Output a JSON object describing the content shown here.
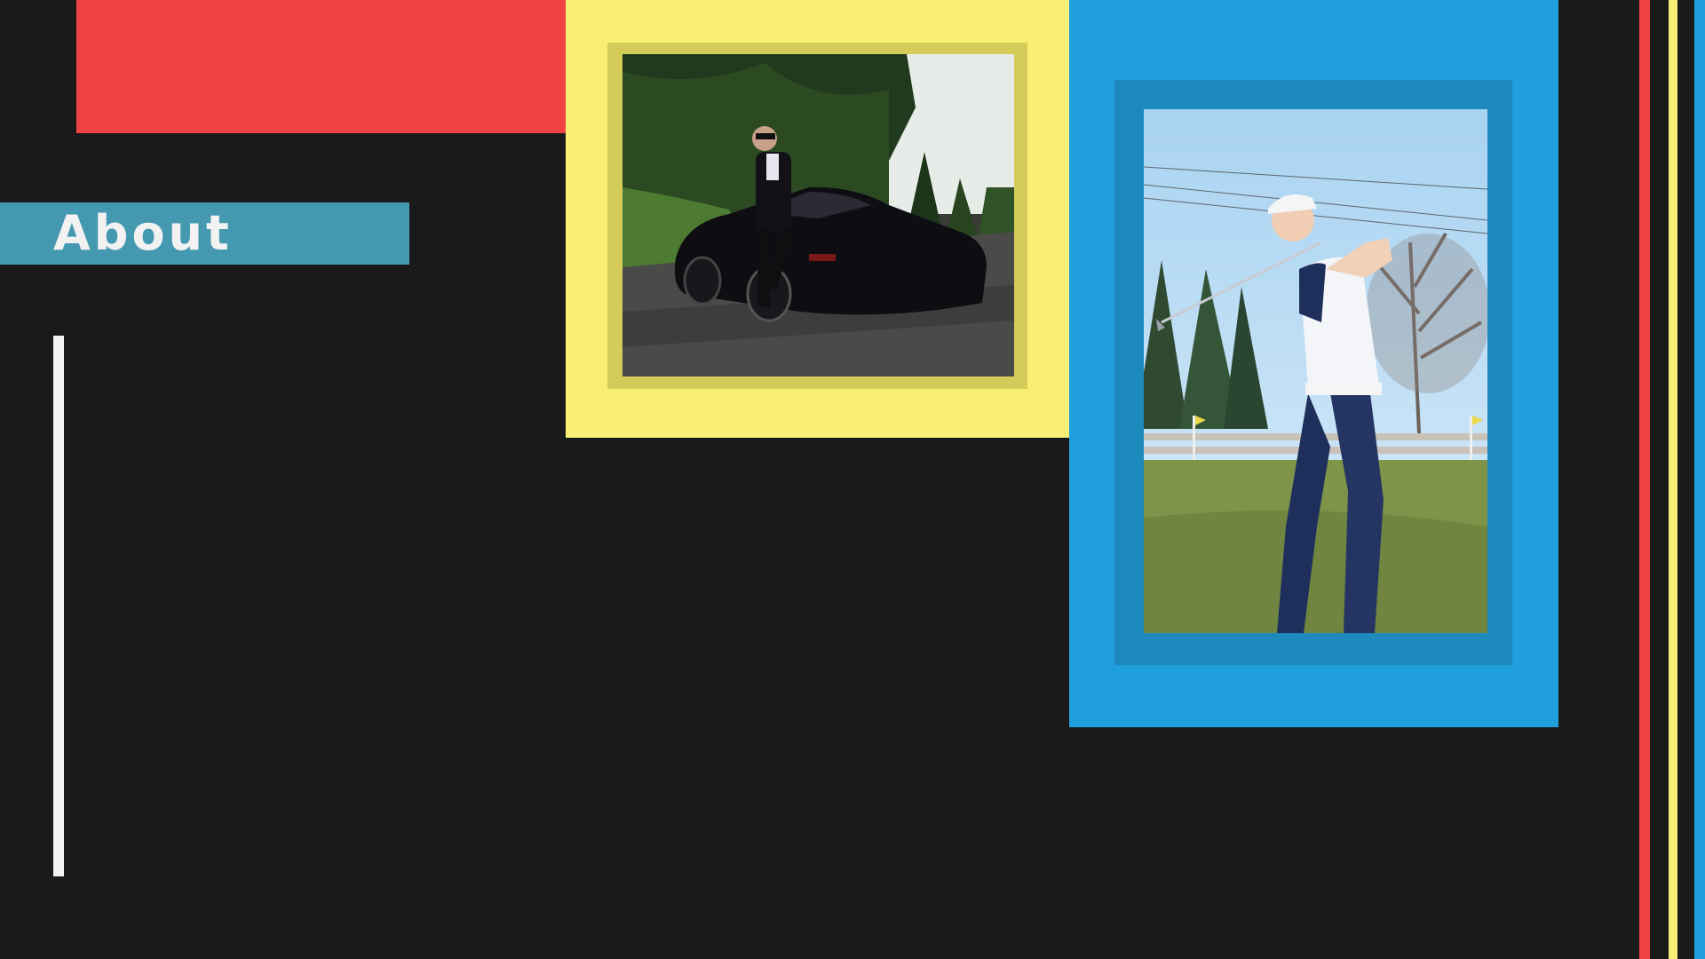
{
  "slide": {
    "title": "About",
    "colors": {
      "background": "#1a1a1a",
      "red": "#f04444",
      "yellow": "#f8ef74",
      "blue": "#1f9fdb",
      "teal": "#4499b0",
      "white": "#f2f2f2"
    }
  },
  "photos": [
    {
      "name": "man-in-tuxedo-with-black-sports-car-photo"
    },
    {
      "name": "golfer-swinging-club-photo"
    }
  ]
}
